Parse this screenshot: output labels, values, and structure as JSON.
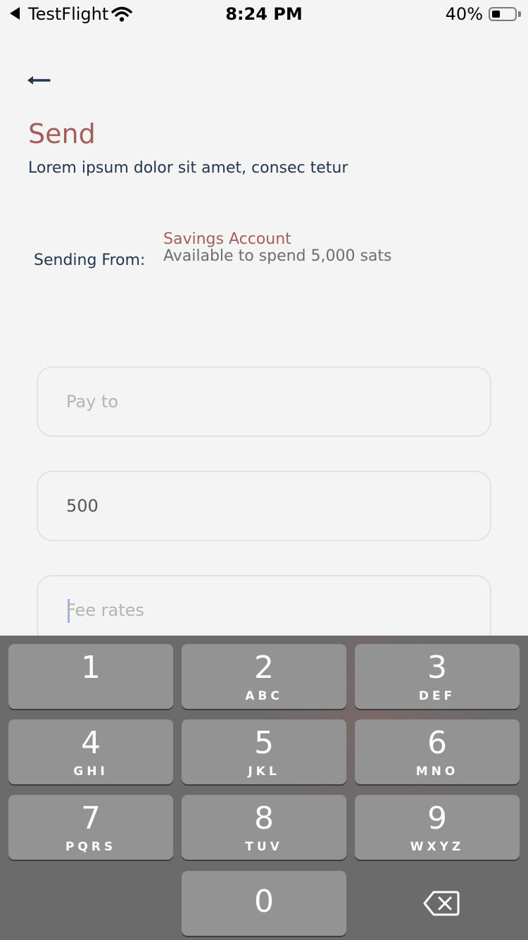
{
  "status_bar": {
    "back_app": "TestFlight",
    "time": "8:24 PM",
    "battery": "40%"
  },
  "header": {
    "title": "Send",
    "subtitle": "Lorem ipsum dolor sit amet, consec tetur"
  },
  "sending_from": {
    "label": "Sending From:",
    "account_name": "Savings Account",
    "available": "Available to spend 5,000 sats"
  },
  "form": {
    "pay_to": {
      "placeholder": "Pay to",
      "value": ""
    },
    "amount": {
      "placeholder": "",
      "value": "500"
    },
    "fee_rates": {
      "placeholder": "Fee rates",
      "value": ""
    }
  },
  "keypad": {
    "keys": [
      {
        "digit": "1",
        "letters": ""
      },
      {
        "digit": "2",
        "letters": "ABC"
      },
      {
        "digit": "3",
        "letters": "DEF"
      },
      {
        "digit": "4",
        "letters": "GHI"
      },
      {
        "digit": "5",
        "letters": "JKL"
      },
      {
        "digit": "6",
        "letters": "MNO"
      },
      {
        "digit": "7",
        "letters": "PQRS"
      },
      {
        "digit": "8",
        "letters": "TUV"
      },
      {
        "digit": "9",
        "letters": "WXYZ"
      },
      {
        "digit": "0",
        "letters": ""
      }
    ],
    "backspace_icon": "delete-left-icon"
  },
  "colors": {
    "accent": "#a45e5a",
    "text": "#24364f",
    "background": "#f4f4f4",
    "keyboard_bg": "#6b6b6b",
    "key_bg": "#939393"
  }
}
